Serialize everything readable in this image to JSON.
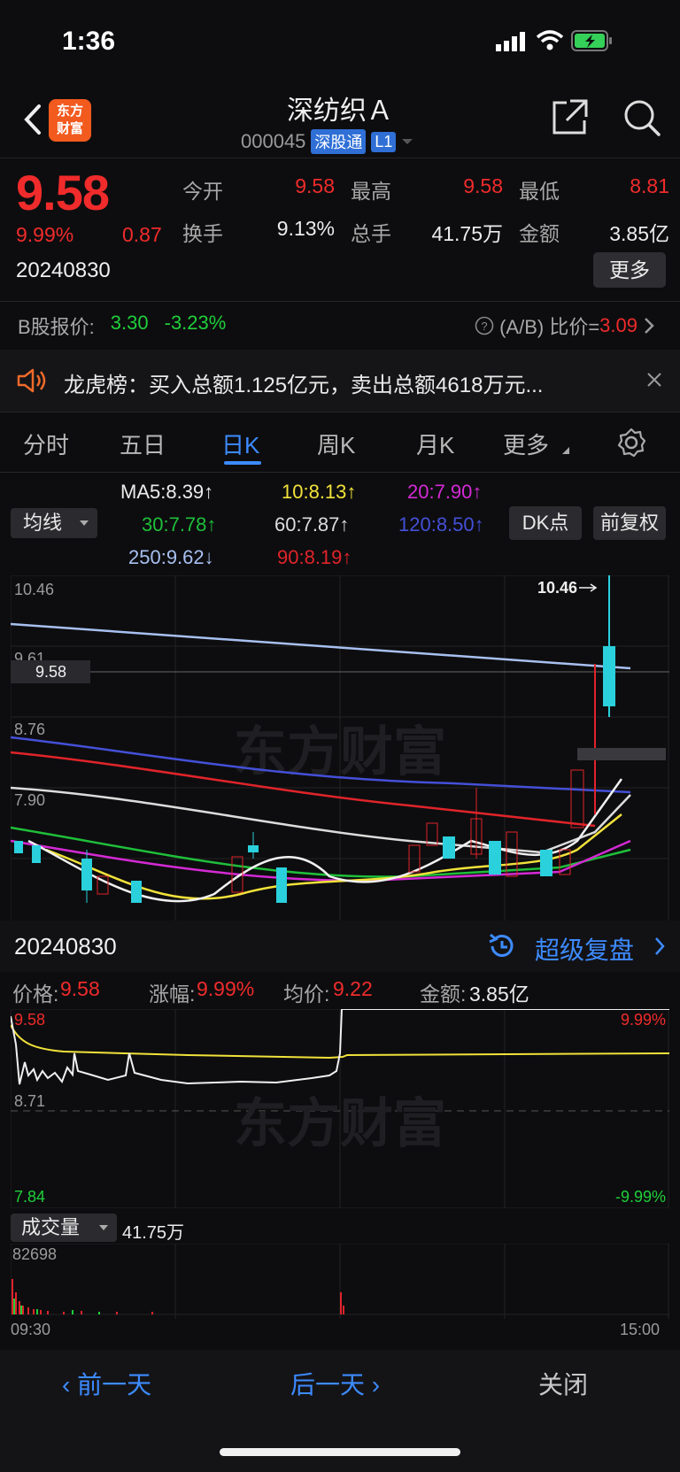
{
  "status_bar": {
    "time": "1:36"
  },
  "header": {
    "logo_text": "东方财富",
    "title": "深纺织Ａ",
    "code": "000045",
    "tag_connect": "深股通",
    "tag_level": "L1"
  },
  "quote": {
    "price": "9.58",
    "change_pct": "9.99%",
    "change": "0.87",
    "date": "20240830",
    "stats": [
      {
        "label": "今开",
        "value": "9.58",
        "color": "#f02b2b"
      },
      {
        "label": "最高",
        "value": "9.58",
        "color": "#f02b2b"
      },
      {
        "label": "最低",
        "value": "8.81",
        "color": "#f02b2b"
      },
      {
        "label": "换手",
        "value": "9.13%",
        "color": "#ececec"
      },
      {
        "label": "总手",
        "value": "41.75万",
        "color": "#ececec"
      },
      {
        "label": "金额",
        "value": "3.85亿",
        "color": "#ececec"
      }
    ],
    "more_label": "更多"
  },
  "b_share": {
    "label": "B股报价:",
    "price": "3.30",
    "pct": "-3.23%",
    "ratio_label": "(A/B) 比价=",
    "ratio_value": "3.09"
  },
  "notice": {
    "text": "龙虎榜：买入总额1.125亿元，卖出总额4618万元..."
  },
  "tabs": [
    {
      "label": "分时"
    },
    {
      "label": "五日"
    },
    {
      "label": "日K"
    },
    {
      "label": "周K"
    },
    {
      "label": "月K"
    },
    {
      "label": "更多"
    }
  ],
  "active_tab": "日K",
  "ma_legend": {
    "ma5": "MA5:8.39↑",
    "ma10": "10:8.13↑",
    "ma20": "20:7.90↑",
    "ma30": "30:7.78↑",
    "ma60": "60:7.87↑",
    "ma120": "120:8.50↑",
    "ma250": "250:9.62↓",
    "ma90": "90:8.19↑",
    "selector_label": "均线",
    "dk_label": "DK点",
    "fq_label": "前复权"
  },
  "kline_axis": {
    "labels": [
      "10.46",
      "9.61",
      "8.76",
      "7.90"
    ],
    "high_marker": "10.46",
    "price_tag": "9.58"
  },
  "day_detail": {
    "date": "20240830",
    "replay_label": "超级复盘",
    "price_label": "价格:",
    "price": "9.58",
    "pct_label": "涨幅:",
    "pct": "9.99%",
    "avg_label": "均价:",
    "avg": "9.22",
    "amount_label": "金额:",
    "amount": "3.85亿"
  },
  "minute_axis": {
    "top_left": "9.58",
    "mid_left": "8.71",
    "bottom_left": "7.84",
    "top_right": "9.99%",
    "bottom_right": "-9.99%"
  },
  "volume": {
    "selector_label": "成交量",
    "total": "41.75万",
    "max_label": "82698",
    "time_start": "09:30",
    "time_end": "15:00"
  },
  "bottom_nav": {
    "prev": "前一天",
    "next": "后一天",
    "close": "关闭"
  },
  "watermark": "东方财富"
}
